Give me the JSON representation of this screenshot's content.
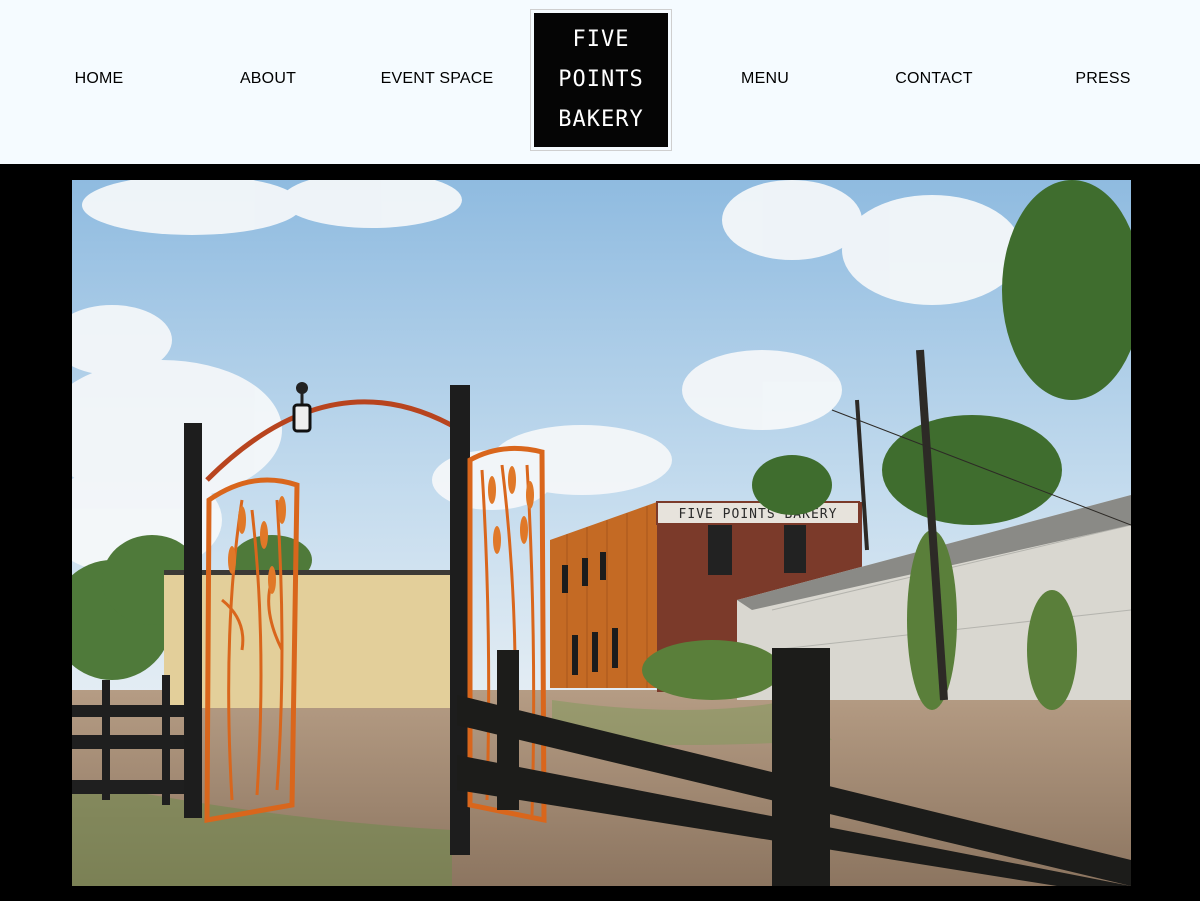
{
  "nav": {
    "home": "HOME",
    "about": "ABOUT",
    "event_space": "EVENT SPACE",
    "menu": "MENU",
    "contact": "CONTACT",
    "press": "PRESS"
  },
  "logo": {
    "line1": "FIVE",
    "line2": "POINTS",
    "line3": "BAKERY"
  },
  "hero": {
    "building_sign": "FIVE POINTS BAKERY"
  },
  "colors": {
    "header_bg": "#f5fbff",
    "frame_bg": "#000000",
    "gate_orange": "#d9661c"
  }
}
